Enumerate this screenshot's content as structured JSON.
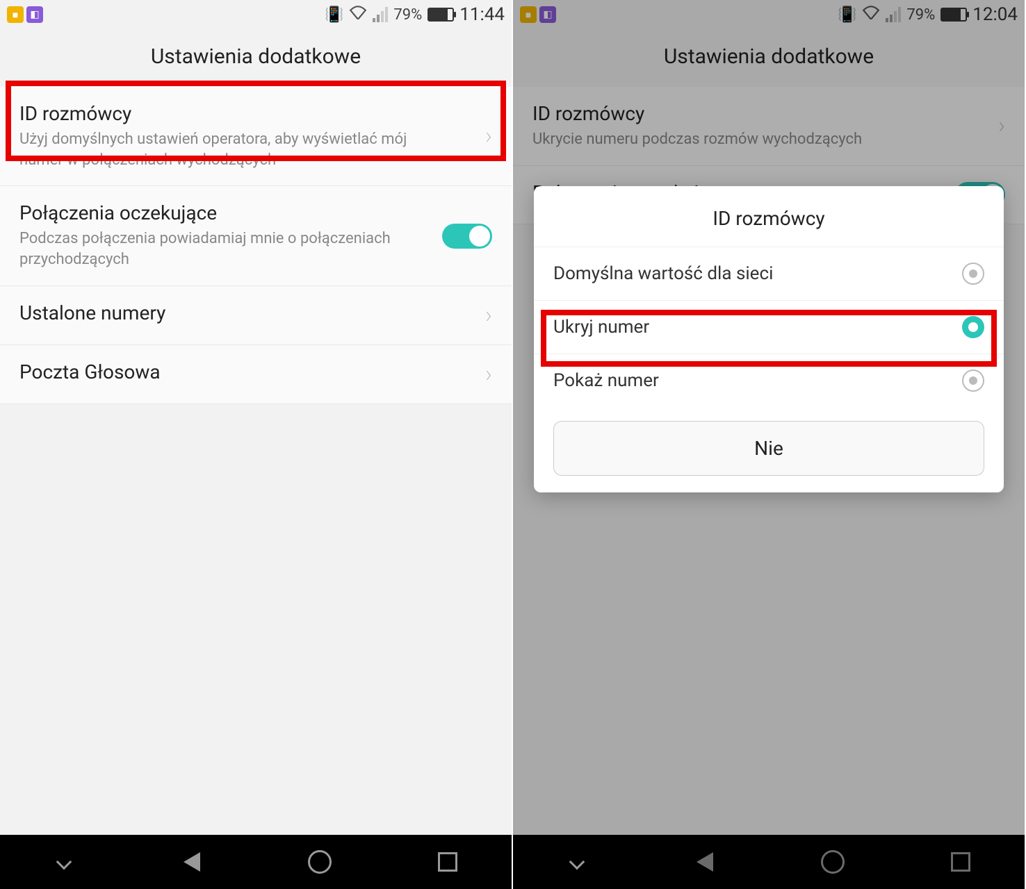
{
  "screen1": {
    "status": {
      "battery_pct": "79%",
      "time": "11:44"
    },
    "header": {
      "title": "Ustawienia dodatkowe"
    },
    "items": {
      "caller_id": {
        "title": "ID rozmówcy",
        "sub": "Użyj domyślnych ustawień operatora, aby wyświetlać mój numer w połączeniach wychodzących"
      },
      "call_waiting": {
        "title": "Połączenia oczekujące",
        "sub": "Podczas połączenia powiadamiaj mnie o połączeniach przychodzących"
      },
      "fixed_numbers": {
        "title": "Ustalone numery"
      },
      "voicemail": {
        "title": "Poczta Głosowa"
      }
    }
  },
  "screen2": {
    "status": {
      "battery_pct": "79%",
      "time": "12:04"
    },
    "header": {
      "title": "Ustawienia dodatkowe"
    },
    "items": {
      "caller_id": {
        "title": "ID rozmówcy",
        "sub": "Ukrycie numeru podczas rozmów wychodzących"
      },
      "call_waiting": {
        "title": "Połączenia oczekujące"
      }
    },
    "dialog": {
      "title": "ID rozmówcy",
      "options": {
        "default": "Domyślna wartość dla sieci",
        "hide": "Ukryj numer",
        "show": "Pokaż numer"
      },
      "cancel": "Nie"
    }
  }
}
